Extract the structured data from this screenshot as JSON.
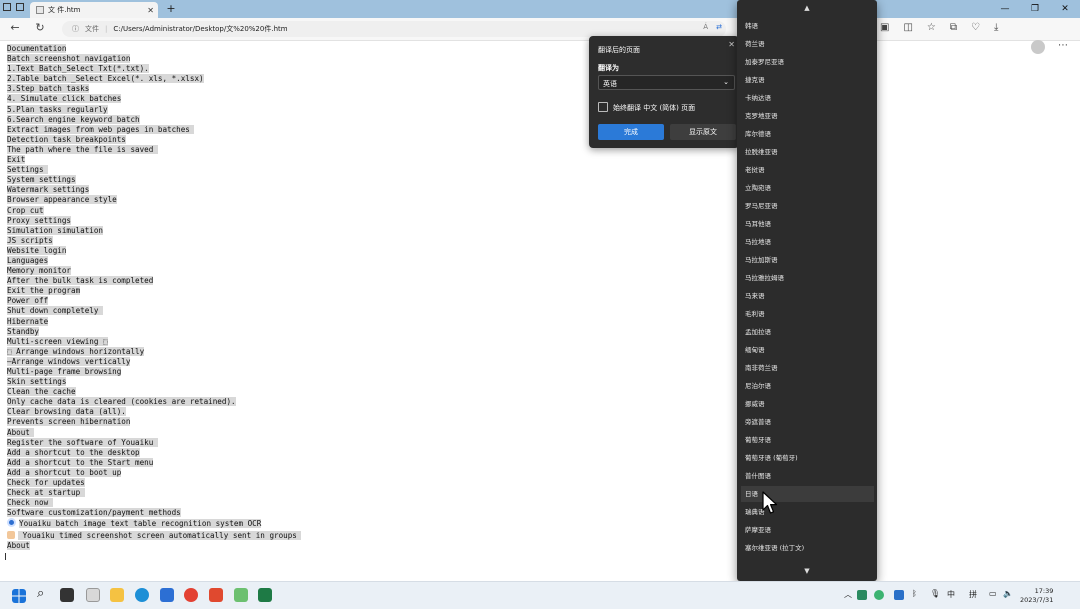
{
  "browser": {
    "tab_title": "文 件.htm",
    "new_tab": "+",
    "url_info": "ⓘ",
    "url_scheme": "文件",
    "url": "C:/Users/Administrator/Desktop/文%20%20件.htm",
    "reader_aa": "Á",
    "colors": {
      "tabstrip": "#9fc1dd",
      "accent": "#2b7ad8"
    }
  },
  "page": {
    "lines": [
      "Documentation",
      "Batch screenshot navigation",
      "1.Text Batch_Select Txt(*.txt).",
      "2.Table batch _Select Excel(*. xls, *.xlsx)",
      "3.Step batch tasks",
      "4. Simulate click batches",
      "5.Plan tasks regularly",
      "6.Search engine keyword batch",
      "Extract images from web pages in batches ",
      "Detection task breakpoints",
      "The path where the file is saved ",
      "Exit",
      "Settings ",
      "System settings",
      "Watermark settings",
      "Browser appearance style",
      "Crop cut",
      "Proxy settings",
      "Simulation simulation",
      "JS scripts",
      "Website login",
      "Languages",
      "Memory monitor",
      "After the bulk task is completed",
      "Exit the program",
      "Power off",
      "Shut down completely ",
      "Hibernate",
      "Standby",
      "Multi-screen viewing ⬚",
      "⬚ Arrange windows horizontally",
      "–Arrange windows vertically",
      "Multi-page frame browsing",
      "Skin settings",
      "Clean the cache",
      "Only cache data is cleared (cookies are retained).",
      "Clear browsing data (all).",
      "Prevents screen hibernation",
      "About ",
      "Register the software of Youaiku ",
      "Add a shortcut to the desktop",
      "Add a shortcut to the Start menu",
      "Add a shortcut to boot up",
      "Check for updates",
      "Check at startup ",
      "Check now ",
      "Software customization/payment methods",
      "Youaiku batch image text table recognition system OCR",
      " Youaiku timed screenshot screen automatically sent in groups ",
      "About"
    ]
  },
  "translate_popup": {
    "title": "翻译后的页面",
    "translate_to_label": "翻译为",
    "selected_language": "英语",
    "always_translate": "始终翻译 中文 (简体) 页面",
    "done_button": "完成",
    "show_original_button": "显示原文"
  },
  "language_list": {
    "items": [
      "韩语",
      "荷兰语",
      "加泰罗尼亚语",
      "捷克语",
      "卡纳达语",
      "克罗地亚语",
      "库尔德语",
      "拉脱维亚语",
      "老挝语",
      "立陶宛语",
      "罗马尼亚语",
      "马耳他语",
      "马拉地语",
      "马拉加斯语",
      "马拉雅拉姆语",
      "马来语",
      "毛利语",
      "孟加拉语",
      "缅甸语",
      "南非荷兰语",
      "尼泊尔语",
      "挪威语",
      "旁遮普语",
      "葡萄牙语",
      "葡萄牙语 (葡萄牙)",
      "普什图语",
      "日语",
      "瑞典语",
      "萨摩亚语",
      "塞尔维亚语 (拉丁文)"
    ],
    "hovered_index": 26
  },
  "taskbar": {
    "ime": "中",
    "ime2": "拼",
    "time": "17:39",
    "date": "2023/7/31"
  }
}
